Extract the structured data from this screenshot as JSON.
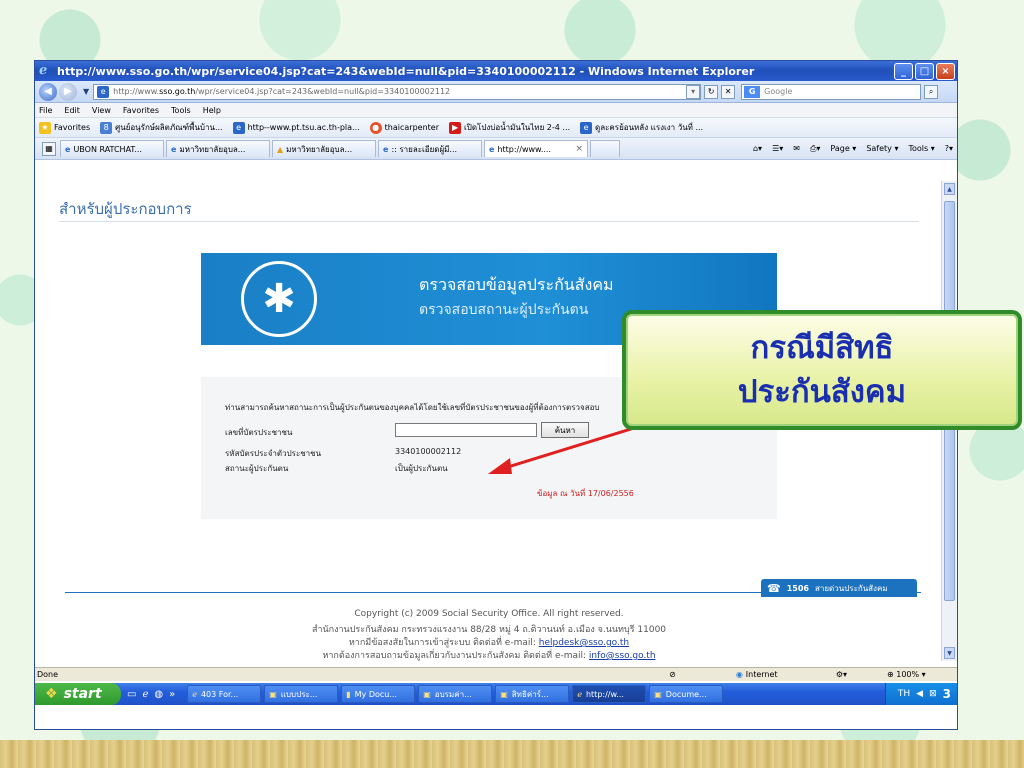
{
  "window": {
    "title": "http://www.sso.go.th/wpr/service04.jsp?cat=243&webId=null&pid=3340100002112 - Windows Internet Explorer",
    "buttons": [
      "_",
      "□",
      "×"
    ]
  },
  "navbar": {
    "address_prefix": "http://www.",
    "address_domain": "sso.go.th",
    "address_rest": "/wpr/service04.jsp?cat=243&webId=null&pid=3340100002112",
    "search_placeholder": "Google"
  },
  "menu": [
    "File",
    "Edit",
    "View",
    "Favorites",
    "Tools",
    "Help"
  ],
  "favorites": {
    "label": "Favorites",
    "items": [
      "ศูนย์อนุรักษ์ผลิตภัณฑ์พื้นบ้าน...",
      "http--www.pt.tsu.ac.th-pla...",
      "thaicarpenter",
      "เปิดโปงบ่อน้ำมันในไทย 2-4 ...",
      "ดูละครย้อนหลัง แรงเงา วันที่ ..."
    ]
  },
  "tabs": [
    {
      "label": "UBON RATCHAT..."
    },
    {
      "label": "มหาวิทยาลัยอุบล..."
    },
    {
      "label": "มหาวิทยาลัยอุบล..."
    },
    {
      "label": ":: รายละเอียดผู้มี..."
    },
    {
      "label": "http://www...."
    }
  ],
  "commands": [
    "Page ▾",
    "Safety ▾",
    "Tools ▾"
  ],
  "page": {
    "section_title": "สำหรับผู้ประกอบการ",
    "banner_title": "ตรวจสอบข้อมูลประกันสังคม",
    "banner_subtitle": "ตรวจสอบสถานะผู้ประกันตน",
    "intro": "ท่านสามารถค้นหาสถานะการเป็นผู้ประกันตนของบุคคลได้โดยใช้เลขที่บัตรประชาชนของผู้ที่ต้องการตรวจสอบ",
    "id_label": "เลขที่บัตรประชาชน",
    "search_button": "ค้นหา",
    "id_code_label": "รหัสบัตรประจำตัวประชาชน",
    "id_code_value": "3340100002112",
    "status_label": "สถานะผู้ประกันตน",
    "status_value": "เป็นผู้ประกันตน",
    "data_as_of": "ข้อมูล ณ วันที่ 17/06/2556",
    "hotline_number": "1506",
    "hotline_label": "สายด่วนประกันสังคม",
    "footer_copyright": "Copyright (c) 2009 Social Security Office. All right reserved.",
    "footer_address": "สำนักงานประกันสังคม กระทรวงแรงงาน 88/28 หมู่ 4 ถ.ติวานนท์ อ.เมือง จ.นนทบุรี 11000",
    "footer_help_text": "หากมีข้อสงสัยในการเข้าสู่ระบบ ติดต่อที่ e-mail:",
    "footer_help_email": "helpdesk@sso.go.th",
    "footer_info_text": "หากต้องการสอบถามข้อมูลเกี่ยวกับงานประกันสังคม ติดต่อที่ e-mail:",
    "footer_info_email": "info@sso.go.th"
  },
  "status_bar": {
    "text": "Done",
    "zone": "Internet",
    "zoom": "100%"
  },
  "taskbar": {
    "start": "start",
    "tasks": [
      "403 For...",
      "แบบประ...",
      "My Docu...",
      "อบรมค่า...",
      "สิทธิค่าร์...",
      "http://w...",
      "Docume..."
    ],
    "lang": "TH",
    "clock": "3"
  },
  "callout": {
    "line1": "กรณีมีสิทธิ",
    "line2": "ประกันสังคม"
  },
  "colors": {
    "accent": "#1d72c0",
    "callout_text": "#1a2fb0",
    "arrow": "#e02020"
  }
}
